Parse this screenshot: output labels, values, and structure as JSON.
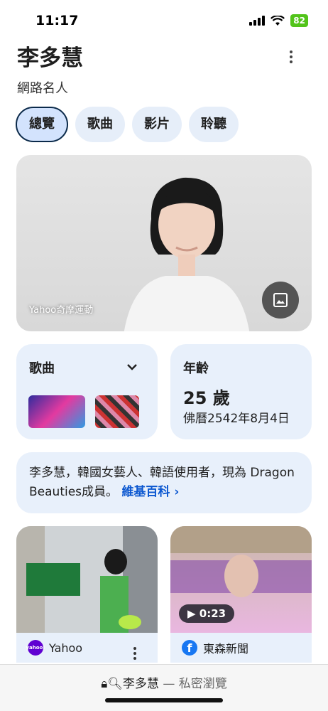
{
  "status": {
    "time": "11:17",
    "battery": "82"
  },
  "header": {
    "title": "李多慧",
    "subtitle": "網路名人"
  },
  "tabs": [
    {
      "label": "總覽",
      "active": true
    },
    {
      "label": "歌曲",
      "active": false
    },
    {
      "label": "影片",
      "active": false
    },
    {
      "label": "聆聽",
      "active": false
    }
  ],
  "hero": {
    "caption": "Yahoo奇摩運動"
  },
  "songs_card": {
    "title": "歌曲"
  },
  "age_card": {
    "title": "年齡",
    "value": "25 歲",
    "birth": "佛曆2542年8月4日"
  },
  "bio": {
    "text": "李多慧，韓國女藝人、韓語使用者，現為 Dragon Beauties成員。",
    "link": "維基百科 ›"
  },
  "media": [
    {
      "source": "Yahoo"
    },
    {
      "source": "東森新聞",
      "duration": "0:23"
    }
  ],
  "address_bar": {
    "query": "李多慧",
    "mode": "— 私密瀏覽"
  },
  "colors": {
    "accent": "#0b57d0",
    "card": "#e8f0fb",
    "tab_active": "#d3e3fd"
  }
}
